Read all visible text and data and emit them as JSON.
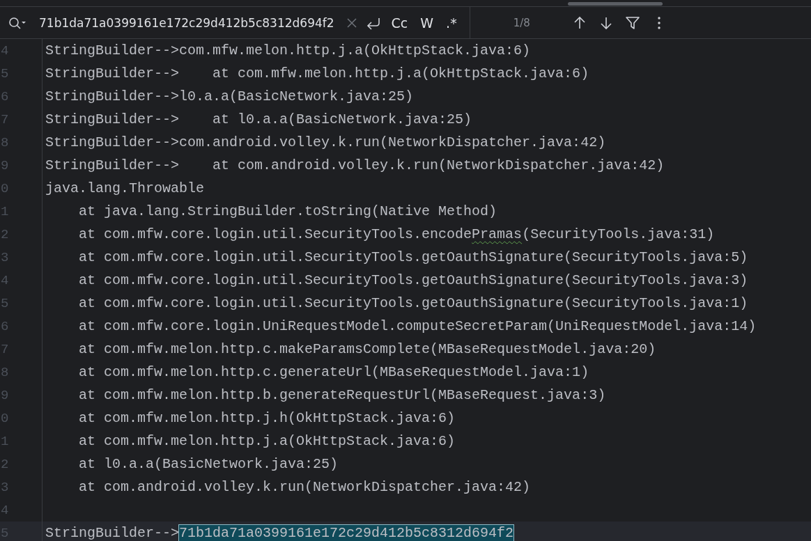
{
  "search": {
    "query": "71b1da71a0399161e172c29d412b5c8312d694f2",
    "options": [
      {
        "label": "Cc",
        "selected": false
      },
      {
        "label": "W",
        "selected": false
      },
      {
        "label": ".*",
        "selected": false
      }
    ],
    "match_count": "1/8"
  },
  "editor": {
    "lines": [
      {
        "number": "4",
        "current": false,
        "parts": [
          {
            "text": "StringBuilder-->com.mfw.melon.http.j.a(OkHttpStack.java:6)",
            "kind": "plain"
          }
        ]
      },
      {
        "number": "5",
        "current": false,
        "parts": [
          {
            "text": "StringBuilder-->    at com.mfw.melon.http.j.a(OkHttpStack.java:6)",
            "kind": "plain"
          }
        ]
      },
      {
        "number": "6",
        "current": false,
        "parts": [
          {
            "text": "StringBuilder-->l0.a.a(BasicNetwork.java:25)",
            "kind": "plain"
          }
        ]
      },
      {
        "number": "7",
        "current": false,
        "parts": [
          {
            "text": "StringBuilder-->    at l0.a.a(BasicNetwork.java:25)",
            "kind": "plain"
          }
        ]
      },
      {
        "number": "8",
        "current": false,
        "parts": [
          {
            "text": "StringBuilder-->com.android.volley.k.run(NetworkDispatcher.java:42)",
            "kind": "plain"
          }
        ]
      },
      {
        "number": "9",
        "current": false,
        "parts": [
          {
            "text": "StringBuilder-->    at com.android.volley.k.run(NetworkDispatcher.java:42)",
            "kind": "plain"
          }
        ]
      },
      {
        "number": "0",
        "current": false,
        "parts": [
          {
            "text": "java.lang.Throwable",
            "kind": "plain"
          }
        ]
      },
      {
        "number": "1",
        "current": false,
        "parts": [
          {
            "text": "    at java.lang.StringBuilder.toString(Native Method)",
            "kind": "plain"
          }
        ]
      },
      {
        "number": "2",
        "current": false,
        "parts": [
          {
            "text": "    at com.mfw.core.login.util.SecurityTools.encode",
            "kind": "plain"
          },
          {
            "text": "Pramas",
            "kind": "typo"
          },
          {
            "text": "(SecurityTools.java:31)",
            "kind": "plain"
          }
        ]
      },
      {
        "number": "3",
        "current": false,
        "parts": [
          {
            "text": "    at com.mfw.core.login.util.SecurityTools.getOauthSignature(SecurityTools.java:5)",
            "kind": "plain"
          }
        ]
      },
      {
        "number": "4",
        "current": false,
        "parts": [
          {
            "text": "    at com.mfw.core.login.util.SecurityTools.getOauthSignature(SecurityTools.java:3)",
            "kind": "plain"
          }
        ]
      },
      {
        "number": "5",
        "current": false,
        "parts": [
          {
            "text": "    at com.mfw.core.login.util.SecurityTools.getOauthSignature(SecurityTools.java:1)",
            "kind": "plain"
          }
        ]
      },
      {
        "number": "6",
        "current": false,
        "parts": [
          {
            "text": "    at com.mfw.core.login.UniRequestModel.computeSecretParam(UniRequestModel.java:14)",
            "kind": "plain"
          }
        ]
      },
      {
        "number": "7",
        "current": false,
        "parts": [
          {
            "text": "    at com.mfw.melon.http.c.makeParamsComplete(MBaseRequestModel.java:20)",
            "kind": "plain"
          }
        ]
      },
      {
        "number": "8",
        "current": false,
        "parts": [
          {
            "text": "    at com.mfw.melon.http.c.generateUrl(MBaseRequestModel.java:1)",
            "kind": "plain"
          }
        ]
      },
      {
        "number": "9",
        "current": false,
        "parts": [
          {
            "text": "    at com.mfw.melon.http.b.generateRequestUrl(MBaseRequest.java:3)",
            "kind": "plain"
          }
        ]
      },
      {
        "number": "0",
        "current": false,
        "parts": [
          {
            "text": "    at com.mfw.melon.http.j.h(OkHttpStack.java:6)",
            "kind": "plain"
          }
        ]
      },
      {
        "number": "1",
        "current": false,
        "parts": [
          {
            "text": "    at com.mfw.melon.http.j.a(OkHttpStack.java:6)",
            "kind": "plain"
          }
        ]
      },
      {
        "number": "2",
        "current": false,
        "parts": [
          {
            "text": "    at l0.a.a(BasicNetwork.java:25)",
            "kind": "plain"
          }
        ]
      },
      {
        "number": "3",
        "current": false,
        "parts": [
          {
            "text": "    at com.android.volley.k.run(NetworkDispatcher.java:42)",
            "kind": "plain"
          }
        ]
      },
      {
        "number": "4",
        "current": false
      },
      {
        "number": "5",
        "current": true,
        "parts": [
          {
            "text": "StringBuilder-->",
            "kind": "plain"
          },
          {
            "text": "71b1da71a0399161e172c29d412b5c8312d694f2",
            "kind": "match"
          }
        ]
      }
    ]
  }
}
